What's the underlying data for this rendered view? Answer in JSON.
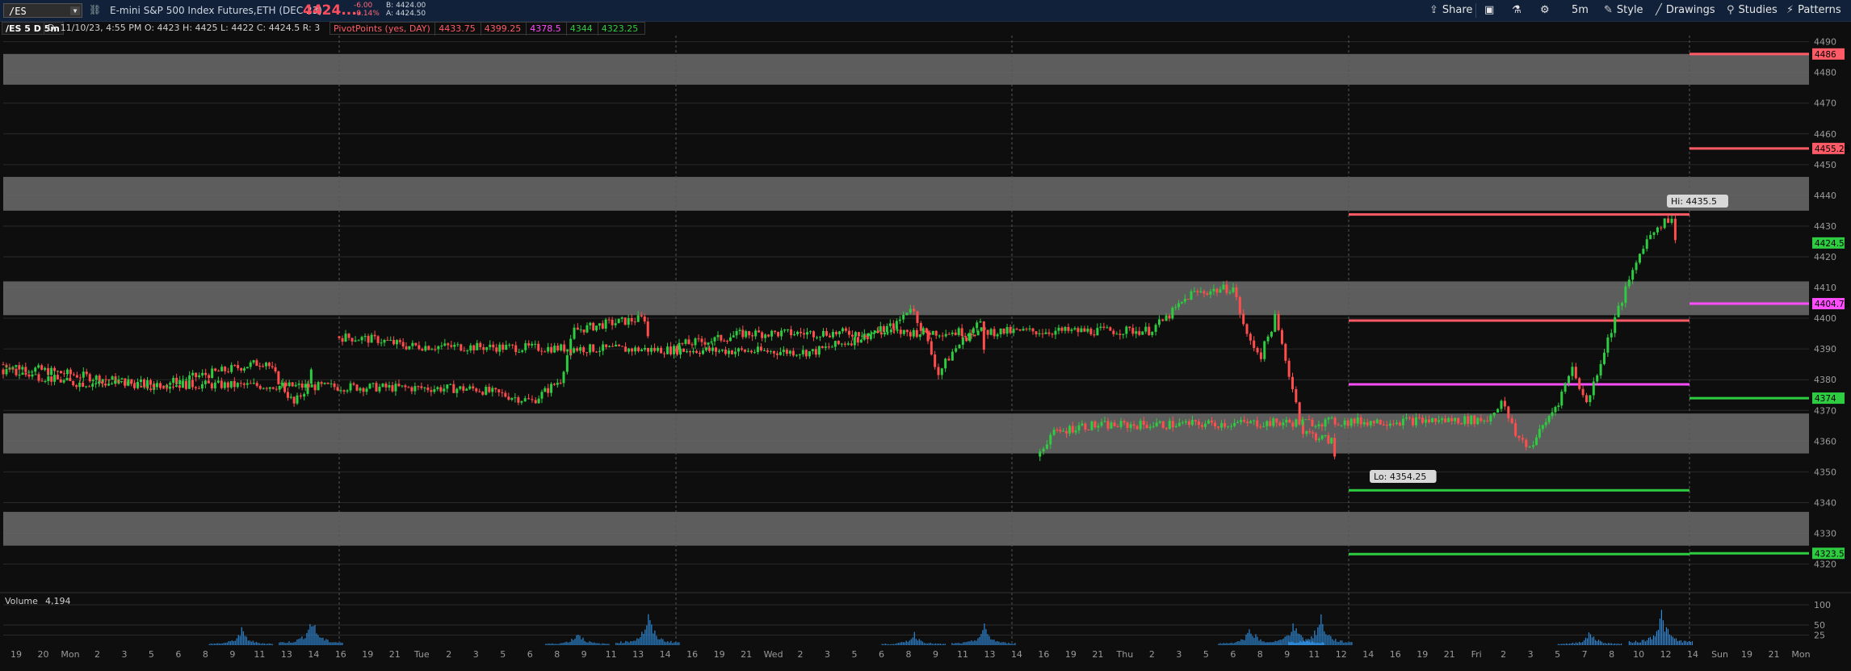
{
  "toolbar": {
    "symbol": "/ES",
    "instrument": "E-mini S&P 500 Index Futures,ETH (DEC 23)",
    "last_price": "4424....",
    "change": "-6.00",
    "change_pct": "-0.14%",
    "bid": "B: 4424.00",
    "ask": "A: 4424.50",
    "share_label": "Share",
    "timeframe_label": "5m",
    "style_label": "Style",
    "drawings_label": "Drawings",
    "studies_label": "Studies",
    "patterns_label": "Patterns"
  },
  "infobar": {
    "symbol_tf": "/ES 5 D 5m",
    "ohlc": "D: 11/10/23, 4:55 PM   O: 4423   H: 4425   L: 4422   C: 4424.5   R: 3",
    "study_name": "PivotPoints (yes, DAY)",
    "pivot_values": [
      {
        "text": "4433.75",
        "color": "#ff5b66"
      },
      {
        "text": "4399.25",
        "color": "#ff5b66"
      },
      {
        "text": "4378.5",
        "color": "#ff4dff"
      },
      {
        "text": "4344",
        "color": "#2ecc40"
      },
      {
        "text": "4323.25",
        "color": "#2ecc40"
      }
    ]
  },
  "volume": {
    "label": "Volume",
    "value": "4,194"
  },
  "colors": {
    "background": "#0e0e0e",
    "grid": "#2a2a2a",
    "zone": "#6b6b6b",
    "resistance": "#ff5b66",
    "pivot": "#ff4dff",
    "support": "#2ecc40",
    "volume": "#2f8ad8",
    "up_candle": "#2ecc40",
    "down_candle": "#ff4d4d",
    "toolbar": "#11213a"
  },
  "chart_data": {
    "type": "candlestick",
    "symbol": "/ES",
    "aggregation": "5m",
    "span_days": 5,
    "ylim": [
      4317,
      4492
    ],
    "y_ticks": [
      "4490",
      "4480",
      "4470",
      "4460",
      "4450",
      "4440",
      "4430",
      "4420",
      "4410",
      "4400",
      "4390",
      "4380",
      "4370",
      "4360",
      "4350",
      "4340",
      "4330",
      "4320"
    ],
    "x_ticks": [
      "19",
      "20",
      "Mon",
      "2",
      "3",
      "5",
      "6",
      "8",
      "9",
      "11",
      "13",
      "14",
      "16",
      "19",
      "21",
      "Tue",
      "2",
      "3",
      "5",
      "6",
      "8",
      "9",
      "11",
      "13",
      "14",
      "16",
      "19",
      "21",
      "Wed",
      "2",
      "3",
      "5",
      "6",
      "8",
      "9",
      "11",
      "13",
      "14",
      "16",
      "19",
      "21",
      "Thu",
      "2",
      "3",
      "5",
      "6",
      "8",
      "9",
      "11",
      "12",
      "14",
      "16",
      "19",
      "21",
      "Fri",
      "2",
      "3",
      "5",
      "7",
      "8",
      "10",
      "12",
      "14",
      "Sun",
      "19",
      "21",
      "Mon"
    ],
    "session_dividers": [
      "Tue",
      "Wed",
      "Thu",
      "Fri",
      "Sun"
    ],
    "zones": [
      [
        4476,
        4486
      ],
      [
        4435,
        4446
      ],
      [
        4401,
        4412
      ],
      [
        4356,
        4369
      ],
      [
        4326,
        4337
      ]
    ],
    "pivot_levels": {
      "current": [
        {
          "value": 4433.75,
          "role": "R1",
          "color": "#ff5b66"
        },
        {
          "value": 4399.25,
          "role": "PP",
          "color": "#ff5b66"
        },
        {
          "value": 4378.5,
          "role": "S",
          "color": "#ff4dff"
        },
        {
          "value": 4344,
          "role": "S1",
          "color": "#2ecc40"
        },
        {
          "value": 4323.25,
          "role": "S2",
          "color": "#2ecc40"
        }
      ],
      "next": [
        {
          "value": 4486,
          "color": "#ff5b66"
        },
        {
          "value": 4455.25,
          "color": "#ff5b66"
        },
        {
          "value": 4404.75,
          "color": "#ff4dff"
        },
        {
          "value": 4374,
          "color": "#2ecc40"
        },
        {
          "value": 4323.5,
          "color": "#2ecc40"
        }
      ]
    },
    "price_path": [
      [
        "Sun",
        4385
      ],
      [
        "Mon 03:00",
        4378
      ],
      [
        "Mon 06:00",
        4381
      ],
      [
        "Mon 09:00",
        4384
      ],
      [
        "Mon 11:00",
        4386
      ],
      [
        "Mon 13:00",
        4372
      ],
      [
        "Mon 14:00",
        4378
      ],
      [
        "Mon 16:00",
        4383
      ],
      [
        "Mon 19:00",
        4381
      ],
      [
        "Mon 21:00",
        4379
      ],
      [
        "Tue 02:00",
        4377
      ],
      [
        "Tue 05:00",
        4374
      ],
      [
        "Tue 06:00",
        4373
      ],
      [
        "Tue 08:00",
        4380
      ],
      [
        "Tue 09:00",
        4396
      ],
      [
        "Tue 11:00",
        4398
      ],
      [
        "Tue 14:00",
        4400
      ],
      [
        "Tue 16:00",
        4394
      ],
      [
        "Tue 19:00",
        4393
      ],
      [
        "Tue 21:00",
        4391
      ],
      [
        "Wed 02:00",
        4389
      ],
      [
        "Wed 05:00",
        4393
      ],
      [
        "Wed 08:00",
        4398
      ],
      [
        "Wed 09:00",
        4404
      ],
      [
        "Wed 10:00",
        4395
      ],
      [
        "Wed 11:00",
        4382
      ],
      [
        "Wed 12:00",
        4389
      ],
      [
        "Wed 13:00",
        4394
      ],
      [
        "Wed 14:00",
        4399
      ],
      [
        "Wed 16:00",
        4391
      ],
      [
        "Wed 19:00",
        4393
      ],
      [
        "Wed 21:00",
        4395
      ],
      [
        "Thu 02:00",
        4396
      ],
      [
        "Thu 03:00",
        4399
      ],
      [
        "Thu 05:00",
        4408
      ],
      [
        "Thu 08:00",
        4410
      ],
      [
        "Thu 09:00",
        4394
      ],
      [
        "Thu 10:00",
        4388
      ],
      [
        "Thu 11:00",
        4400
      ],
      [
        "Thu 12:00",
        4382
      ],
      [
        "Thu 13:00",
        4363
      ],
      [
        "Thu 15:00",
        4360
      ],
      [
        "Thu 18:00",
        4355
      ],
      [
        "Thu 19:00",
        4362
      ],
      [
        "Thu 21:00",
        4365
      ],
      [
        "Fri 02:00",
        4367
      ],
      [
        "Fri 03:00",
        4373
      ],
      [
        "Fri 04:00",
        4362
      ],
      [
        "Fri 05:00",
        4358
      ],
      [
        "Fri 07:00",
        4373
      ],
      [
        "Fri 08:00",
        4384
      ],
      [
        "Fri 09:00",
        4372
      ],
      [
        "Fri 10:00",
        4386
      ],
      [
        "Fri 11:00",
        4400
      ],
      [
        "Fri 12:00",
        4412
      ],
      [
        "Fri 13:00",
        4424
      ],
      [
        "Fri 14:00",
        4430
      ],
      [
        "Fri 15:00",
        4433
      ],
      [
        "Fri 16:00",
        4424.5
      ]
    ],
    "hi_label": "Hi: 4435.5",
    "lo_label": "Lo: 4354.25",
    "last_price_label": "4424.5",
    "volume_axis": [
      "100",
      "50",
      "25"
    ],
    "volume_bars": [
      [
        "Mon 09:00",
        45
      ],
      [
        "Mon 14:00",
        80
      ],
      [
        "Tue 09:00",
        40
      ],
      [
        "Tue 14:00",
        85
      ],
      [
        "Wed 09:00",
        35
      ],
      [
        "Wed 14:00",
        55
      ],
      [
        "Thu 09:00",
        55
      ],
      [
        "Thu 12:00",
        70
      ],
      [
        "Thu 14:00",
        85
      ],
      [
        "Fri 09:00",
        40
      ],
      [
        "Fri 14:00",
        95
      ]
    ]
  }
}
